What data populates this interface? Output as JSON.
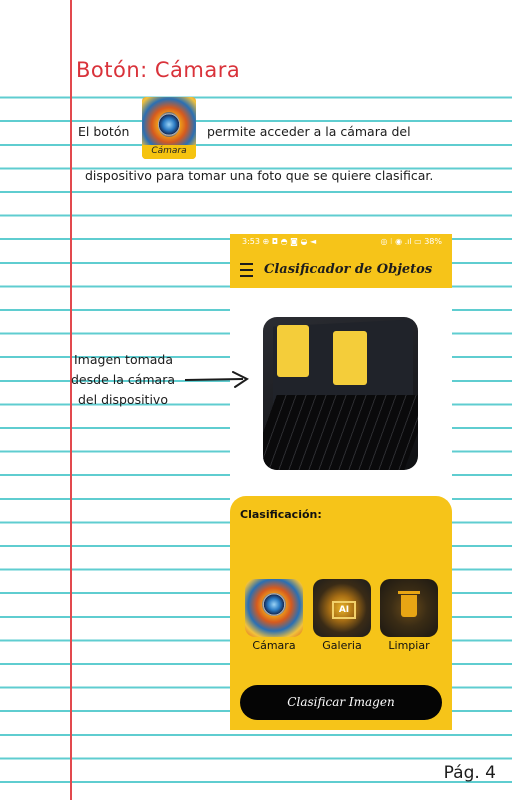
{
  "page": {
    "title": "Botón: Cámara",
    "paragraph_before_icon": "El botón",
    "paragraph_after_icon": "permite acceder a la cámara del",
    "paragraph_line2": "dispositivo para tomar una foto que se quiere clasificar.",
    "inline_icon_caption": "Cámara",
    "annotation_line1": "Imagen tomada",
    "annotation_line2": "desde la cámara",
    "annotation_line3": "del dispositivo",
    "page_number": "Pág. 4"
  },
  "app": {
    "status_left": "3:53 ⊕ ◘ ◓ ◙ ◒ ◄",
    "status_right": "◎ ⁝ ◉ .ıl ▭ 38%",
    "title": "Clasificador de Objetos",
    "classification_label": "Clasificación:",
    "options": [
      {
        "label": "Cámara",
        "icon": "camera-icon"
      },
      {
        "label": "Galeria",
        "icon": "gallery-ai-icon"
      },
      {
        "label": "Limpiar",
        "icon": "trash-icon"
      }
    ],
    "classify_button": "Clasificar Imagen"
  },
  "colors": {
    "accent": "#f6c419",
    "title_red": "#d9323a",
    "rule_blue": "#5fcdd0",
    "margin_red": "#e2494e",
    "button_black": "#050505"
  }
}
